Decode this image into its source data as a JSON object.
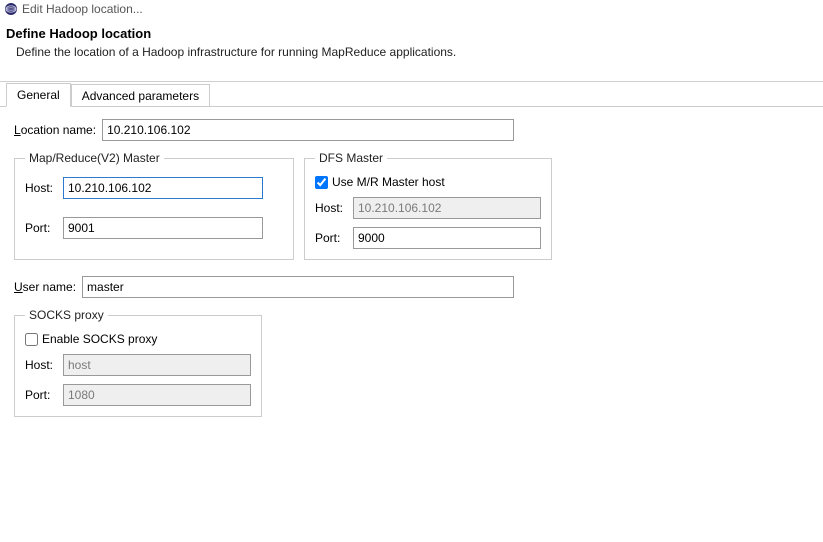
{
  "window": {
    "title": "Edit Hadoop location..."
  },
  "header": {
    "title": "Define Hadoop location",
    "subtitle": "Define the location of a Hadoop infrastructure for running MapReduce applications."
  },
  "tabs": {
    "general": "General",
    "advanced": "Advanced parameters"
  },
  "form": {
    "location_name_label_pre": "L",
    "location_name_label_post": "ocation name:",
    "location_name_value": "10.210.106.102",
    "mr_group_legend": "Map/Reduce(V2) Master",
    "mr_host_label": "Host:",
    "mr_host_value": "10.210.106.102",
    "mr_port_label": "Port:",
    "mr_port_value": "9001",
    "dfs_group_legend": "DFS Master",
    "dfs_use_mr_label": "Use M/R Master host",
    "dfs_use_mr_checked": true,
    "dfs_host_label": "Host:",
    "dfs_host_value": "10.210.106.102",
    "dfs_port_label": "Port:",
    "dfs_port_value": "9000",
    "user_name_label_pre": "U",
    "user_name_label_post": "ser name:",
    "user_name_value": "master",
    "socks_group_legend": "SOCKS proxy",
    "socks_enable_label": "Enable SOCKS proxy",
    "socks_enable_checked": false,
    "socks_host_label": "Host:",
    "socks_host_value": "host",
    "socks_port_label": "Port:",
    "socks_port_value": "1080"
  }
}
